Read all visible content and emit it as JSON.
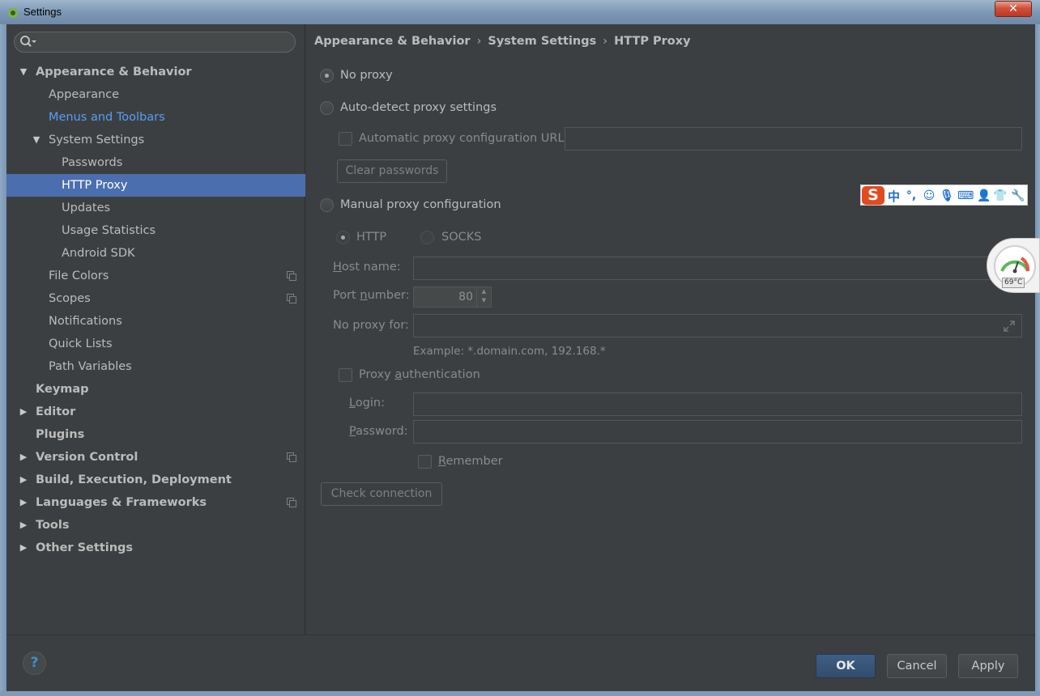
{
  "window": {
    "title": "Settings",
    "close_label": "✕"
  },
  "sidebar": {
    "search_placeholder": "",
    "items": [
      {
        "label": "Appearance & Behavior",
        "expanded": true
      },
      {
        "label": "Appearance"
      },
      {
        "label": "Menus and Toolbars",
        "highlight": true
      },
      {
        "label": "System Settings",
        "expanded": true
      },
      {
        "label": "Passwords"
      },
      {
        "label": "HTTP Proxy",
        "selected": true
      },
      {
        "label": "Updates"
      },
      {
        "label": "Usage Statistics"
      },
      {
        "label": "Android SDK"
      },
      {
        "label": "File Colors",
        "project_icon": true
      },
      {
        "label": "Scopes",
        "project_icon": true
      },
      {
        "label": "Notifications"
      },
      {
        "label": "Quick Lists"
      },
      {
        "label": "Path Variables"
      },
      {
        "label": "Keymap"
      },
      {
        "label": "Editor",
        "collapsed": true
      },
      {
        "label": "Plugins"
      },
      {
        "label": "Version Control",
        "collapsed": true,
        "project_icon": true
      },
      {
        "label": "Build, Execution, Deployment",
        "collapsed": true
      },
      {
        "label": "Languages & Frameworks",
        "collapsed": true,
        "project_icon": true
      },
      {
        "label": "Tools",
        "collapsed": true
      },
      {
        "label": "Other Settings",
        "collapsed": true
      }
    ]
  },
  "breadcrumb": {
    "items": [
      "Appearance & Behavior",
      "System Settings",
      "HTTP Proxy"
    ],
    "separator": "›"
  },
  "proxy": {
    "no_proxy_label": "No proxy",
    "auto_detect_label": "Auto-detect proxy settings",
    "auto_config_url_label": "Automatic proxy configuration URL:",
    "auto_config_url_value": "",
    "clear_passwords_label": "Clear passwords",
    "manual_label": "Manual proxy configuration",
    "http_label": "HTTP",
    "socks_label": "SOCKS",
    "host_name_label_pre": "",
    "host_name_label_u": "H",
    "host_name_label_post": "ost name:",
    "host_name_value": "",
    "port_label_pre": "Port ",
    "port_label_u": "n",
    "port_label_post": "umber:",
    "port_value": "80",
    "no_proxy_for_label": "No proxy for:",
    "no_proxy_for_value": "",
    "example_text": "Example: *.domain.com, 192.168.*",
    "proxy_auth_pre": "Proxy ",
    "proxy_auth_u": "a",
    "proxy_auth_post": "uthentication",
    "login_u": "L",
    "login_post": "ogin:",
    "login_value": "",
    "password_u": "P",
    "password_post": "assword:",
    "password_value": "",
    "remember_u": "R",
    "remember_post": "emember",
    "check_connection_label": "Check connection",
    "selected_mode": "no_proxy"
  },
  "footer": {
    "help_label": "?",
    "ok_label": "OK",
    "cancel_label": "Cancel",
    "apply_label": "Apply"
  },
  "overlays": {
    "ime_logo": "S",
    "ime_mode": "中",
    "ime_punct": "°,",
    "gauge_temp": "69°C"
  },
  "colors": {
    "background": "#3c3f41",
    "selection": "#4b6eaf",
    "link": "#589df6",
    "text": "#bbbbbb"
  }
}
